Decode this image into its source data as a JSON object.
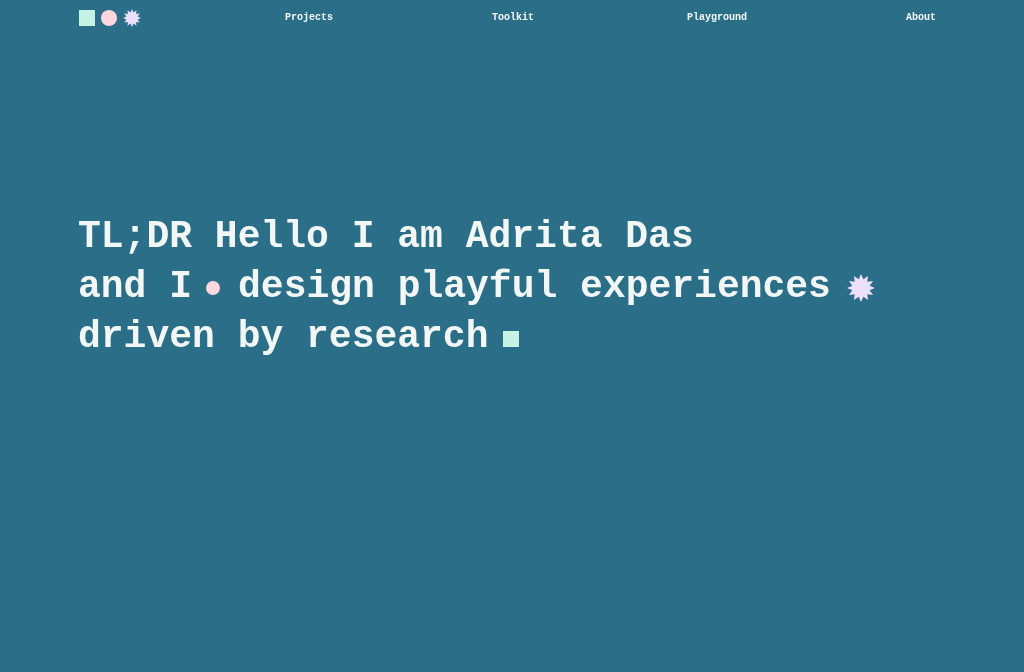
{
  "nav": [
    {
      "label": "Projects"
    },
    {
      "label": "Toolkit"
    },
    {
      "label": "Playground"
    },
    {
      "label": "About"
    }
  ],
  "headline": {
    "lines": [
      [
        {
          "kind": "text",
          "text": "TL;DR Hello I am Adrita Das"
        }
      ],
      [
        {
          "kind": "text",
          "text": "and I"
        },
        {
          "kind": "dot"
        },
        {
          "kind": "text",
          "text": "design playful experiences"
        },
        {
          "kind": "star"
        }
      ],
      [
        {
          "kind": "text",
          "text": "driven by research"
        },
        {
          "kind": "square"
        }
      ]
    ]
  }
}
